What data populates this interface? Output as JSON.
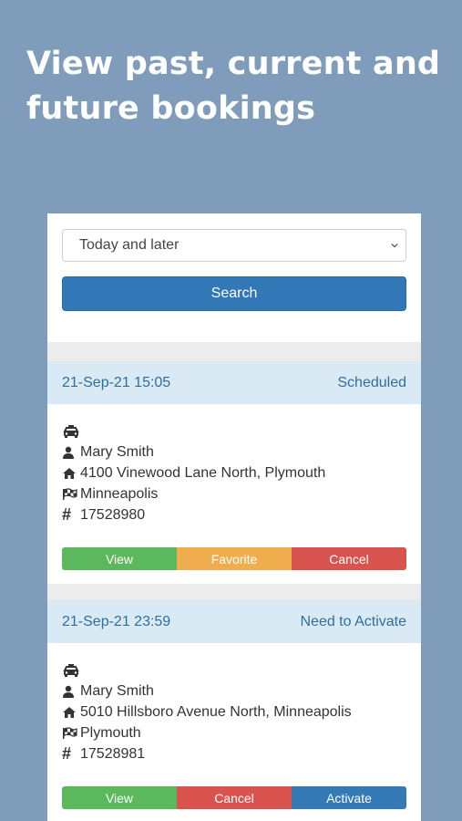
{
  "headline": "View past, current and future bookings",
  "filter": {
    "selected": "Today and later"
  },
  "search_label": "Search",
  "bookings": [
    {
      "datetime": "21-Sep-21 15:05",
      "status": "Scheduled",
      "passenger": "Mary Smith",
      "pickup": "4100 Vinewood Lane North, Plymouth",
      "destination": "Minneapolis",
      "number": "17528980",
      "actions": [
        "View",
        "Favorite",
        "Cancel"
      ]
    },
    {
      "datetime": "21-Sep-21 23:59",
      "status": "Need to Activate",
      "passenger": "Mary Smith",
      "pickup": "5010 Hillsboro Avenue North, Minneapolis",
      "destination": "Plymouth",
      "number": "17528981",
      "actions": [
        "View",
        "Cancel",
        "Activate"
      ]
    }
  ]
}
